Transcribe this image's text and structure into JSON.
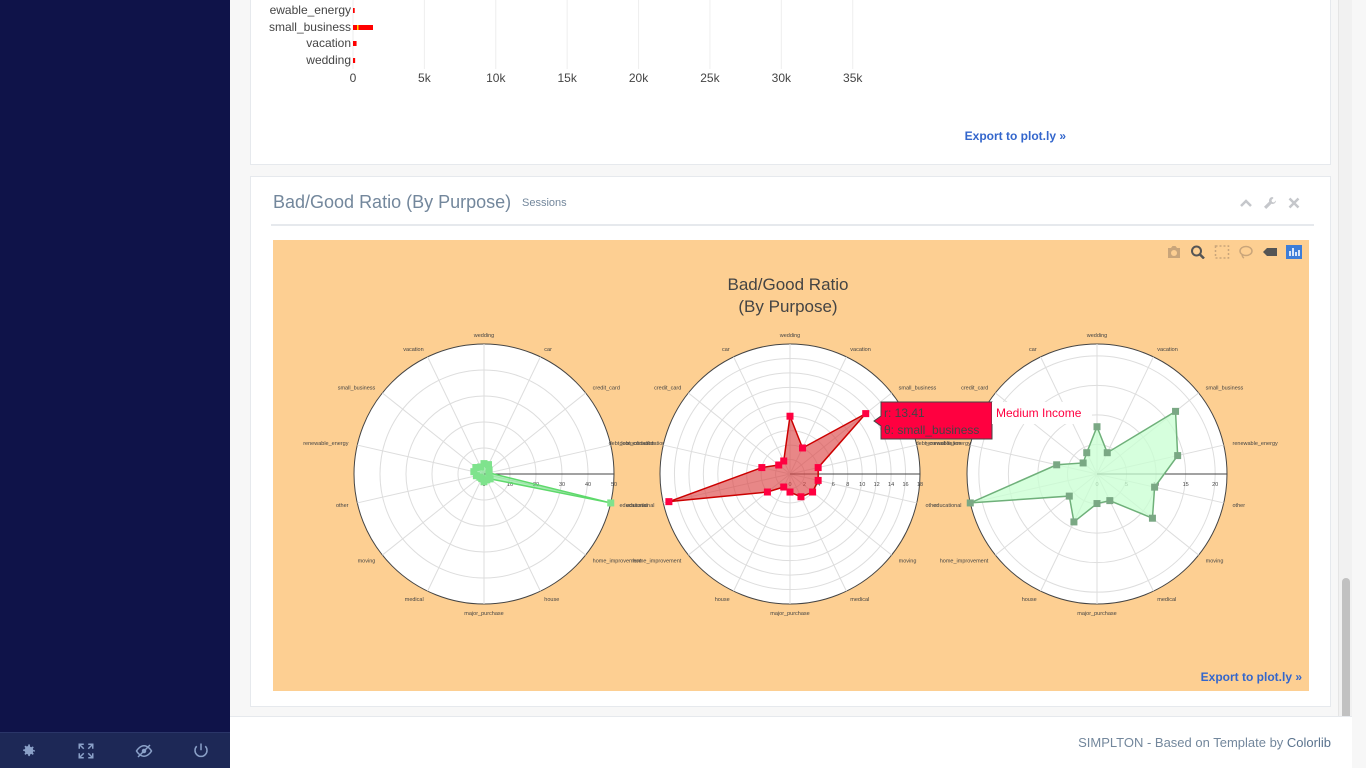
{
  "sidebar": {
    "footer_buttons": [
      {
        "name": "settings",
        "icon": "gear-icon"
      },
      {
        "name": "fullscreen",
        "icon": "fullscreen-icon"
      },
      {
        "name": "lock",
        "icon": "eye-slash-icon"
      },
      {
        "name": "logout",
        "icon": "power-icon"
      }
    ]
  },
  "top_chart": {
    "chart_data": {
      "type": "bar",
      "orientation": "horizontal",
      "categories": [
        "renewable_energy",
        "small_business",
        "vacation",
        "wedding"
      ],
      "category_labels_visible": [
        "ewable_energy",
        "small_business",
        "vacation",
        "wedding"
      ],
      "series": [
        {
          "color": "#ff0000",
          "values": [
            120,
            1400,
            250,
            150
          ]
        },
        {
          "color": "#ffd700",
          "values": [
            0,
            60,
            0,
            0
          ]
        }
      ],
      "xticks": [
        "0",
        "5k",
        "10k",
        "15k",
        "20k",
        "25k",
        "30k",
        "35k"
      ],
      "xtick_values": [
        0,
        5000,
        10000,
        15000,
        20000,
        25000,
        30000,
        35000
      ],
      "xlim": [
        0,
        36000
      ],
      "grid": true
    },
    "export_label": "Export to plot.ly »"
  },
  "ratio_panel": {
    "title": "Bad/Good Ratio (By Purpose)",
    "subtitle": "Sessions",
    "tools": [
      "chevron-up-icon",
      "wrench-icon",
      "close-icon"
    ],
    "export_label": "Export to plot.ly »",
    "modebar": [
      "camera-icon",
      "zoom-icon",
      "box-select-icon",
      "lasso-icon",
      "tag-icon",
      "plotly-logo-icon"
    ],
    "chart_data": {
      "type": "polar",
      "title": "Bad/Good Ratio",
      "subtitle": "(By Purpose)",
      "background": "#fdcf92",
      "charts": [
        {
          "angles_start": [
            "wedding",
            "car",
            "credit_card",
            "debt_consolidation",
            "educational",
            "home_improvement",
            "house",
            "major_purchase",
            "medical",
            "moving",
            "other",
            "renewable_energy",
            "small_business",
            "vacation"
          ],
          "radial_ticks": [
            "0",
            "10",
            "20",
            "30",
            "40",
            "50"
          ],
          "rmax": 50,
          "color": "#5ed96b",
          "fill": "rgba(110,230,130,0.55)",
          "values": [
            4,
            4,
            2.5,
            2,
            50,
            3,
            2.5,
            3,
            2,
            2,
            3,
            4,
            4,
            3
          ]
        },
        {
          "angles_start": [
            "wedding",
            "vacation",
            "small_business",
            "renewable_energy",
            "other",
            "moving",
            "medical",
            "major_purchase",
            "house",
            "home_improvement",
            "educational",
            "debt_consolidation",
            "credit_card",
            "car"
          ],
          "radial_ticks": [
            "0",
            "2",
            "4",
            "6",
            "8",
            "10",
            "12",
            "14",
            "16",
            "18"
          ],
          "rmax": 18,
          "color": "#cc0000",
          "fill": "rgba(220,70,70,0.65)",
          "values": [
            8,
            4,
            13.41,
            4,
            4,
            4,
            3.5,
            2.5,
            2,
            4,
            17.2,
            4,
            2,
            2
          ]
        },
        {
          "angles_start": [
            "wedding",
            "vacation",
            "small_business",
            "renewable_energy",
            "other",
            "moving",
            "medical",
            "major_purchase",
            "house",
            "home_improvement",
            "educational",
            "debt_consolidation",
            "credit_card",
            "car"
          ],
          "radial_ticks": [
            "0",
            "5",
            "10",
            "15",
            "20"
          ],
          "rmax": 22,
          "color": "#6fb07a",
          "fill": "rgba(200,255,210,0.75)",
          "values": [
            8,
            4,
            17,
            14,
            10,
            12,
            5,
            5,
            9,
            6,
            22,
            7,
            3,
            4
          ]
        }
      ],
      "tooltip": {
        "r_label": "r: 13.41",
        "theta_label": "θ: small_business",
        "series": "Medium Income",
        "color": "#ff0040"
      }
    }
  },
  "footer": {
    "text": "SIMPLTON - Based on Template by ",
    "link": "Colorlib"
  }
}
